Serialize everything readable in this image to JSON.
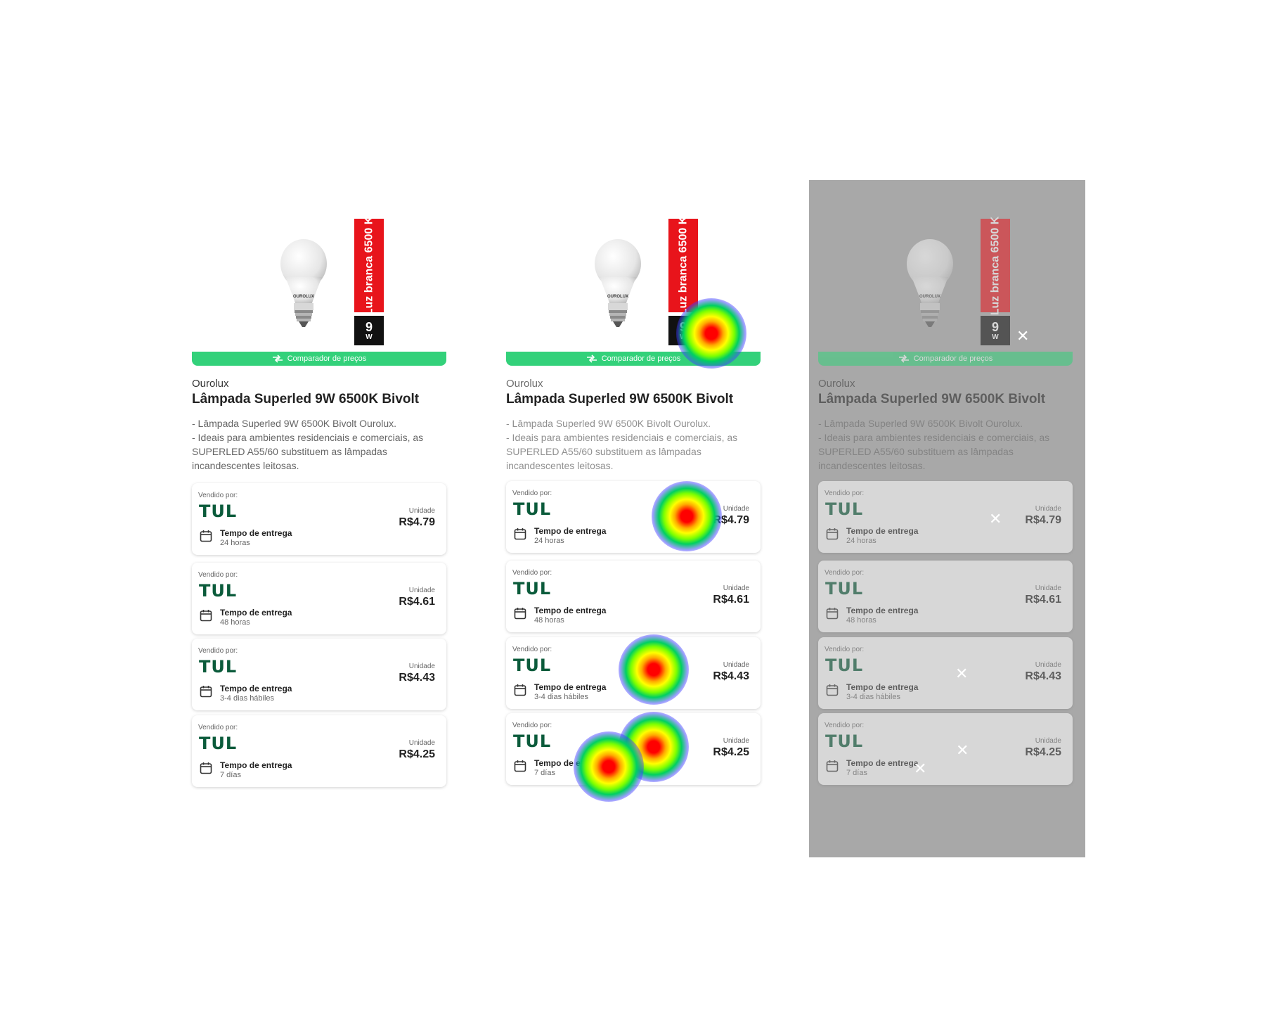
{
  "product": {
    "label_vertical": "Luz branca 6500 K",
    "watt_number": "9",
    "watt_unit": "W",
    "compare_label": "Comparador de preços",
    "brand": "Ourolux",
    "title": "Lâmpada Superled 9W 6500K Bivolt",
    "desc_line1": "- Lâmpada Superled 9W 6500K Bivolt Ourolux.",
    "desc_line2": "- Ideais para ambientes residenciais e comerciais, as SUPERLED A55/60 substituem as lâmpadas incandescentes leitosas.",
    "bulb_brand": "OUROLUX"
  },
  "offers": [
    {
      "sold_by": "Vendido por:",
      "seller": "TUL",
      "delivery_label": "Tempo de entrega",
      "delivery_value": "24 horas",
      "unit_label": "Unidade",
      "price": "R$4.79"
    },
    {
      "sold_by": "Vendido por:",
      "seller": "TUL",
      "delivery_label": "Tempo de entrega",
      "delivery_value": "48 horas",
      "unit_label": "Unidade",
      "price": "R$4.61"
    },
    {
      "sold_by": "Vendido por:",
      "seller": "TUL",
      "delivery_label": "Tempo de entrega",
      "delivery_value": "3-4 dias hábiles",
      "unit_label": "Unidade",
      "price": "R$4.43"
    },
    {
      "sold_by": "Vendido por:",
      "seller": "TUL",
      "delivery_label": "Tempo de entrega",
      "delivery_value": "7 días",
      "unit_label": "Unidade",
      "price": "R$4.25"
    }
  ],
  "colors": {
    "accent_green": "#33d17a",
    "brand_green": "#0b5b3b",
    "label_red": "#e8141b",
    "overlay_gray": "#a8a8a8"
  },
  "icons": {
    "calendar": "calendar-icon",
    "compare": "compare-arrows-icon",
    "close": "close-icon"
  }
}
